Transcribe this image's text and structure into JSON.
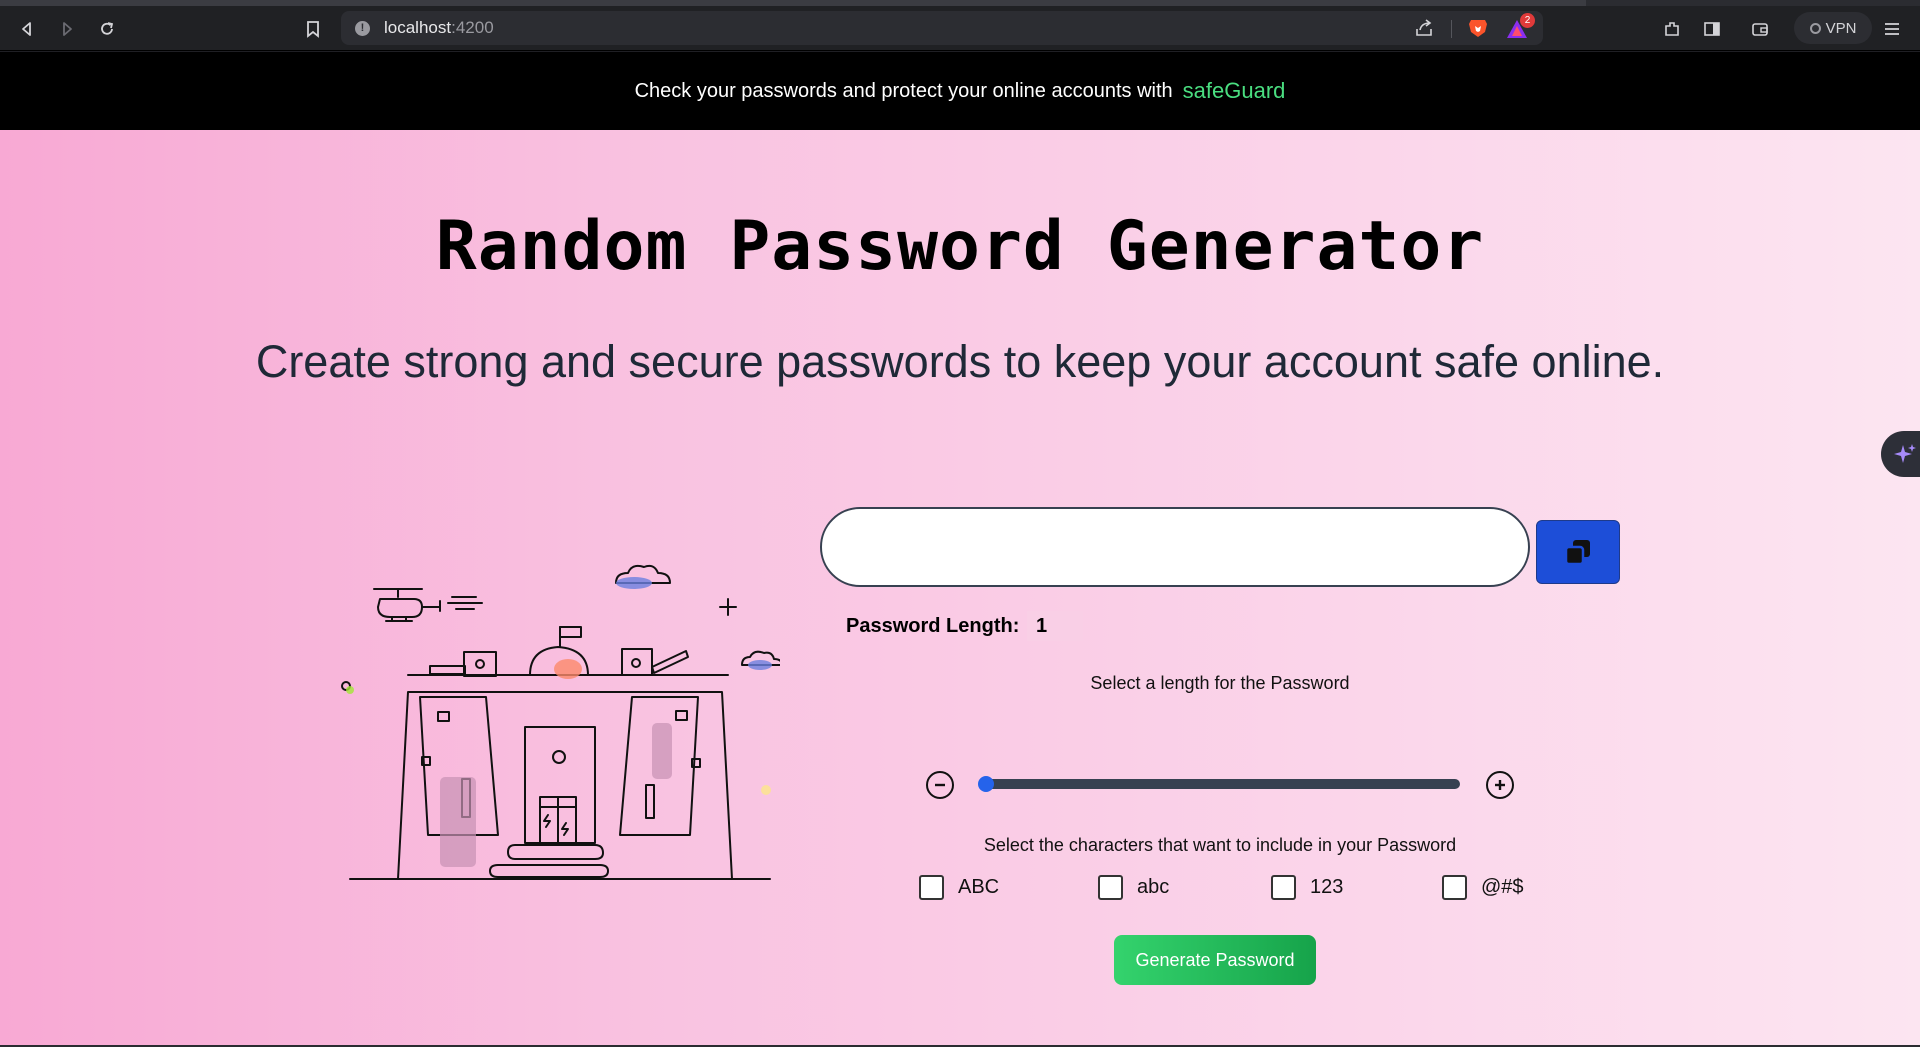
{
  "browser": {
    "url_host": "localhost",
    "url_port": ":4200",
    "vpn_label": "VPN",
    "notification_count": "2",
    "icons": [
      "back-icon",
      "forward-icon",
      "reload-icon",
      "bookmark-icon",
      "site-info-icon",
      "share-icon",
      "brave-shields-icon",
      "brave-rewards-icon",
      "extensions-icon",
      "sidebar-icon",
      "wallet-icon",
      "vpn-icon",
      "menu-icon"
    ]
  },
  "banner": {
    "text": "Check your passwords and protect your online accounts with",
    "brand": "safeGuard",
    "brand_color": "#4ade80"
  },
  "hero": {
    "title": "Random Password Generator",
    "subtitle": "Create strong and secure passwords to keep your account safe online."
  },
  "generator": {
    "password_value": "",
    "copy_icon": "copy-icon",
    "length_label": "Password Length:",
    "length_value": "1",
    "length_fraction": 0.0,
    "select_length_text": "Select a length for the Password",
    "decrease_icon": "minus-circle-icon",
    "increase_icon": "plus-circle-icon",
    "select_chars_text": "Select the characters that want to include in your Password",
    "options": [
      {
        "label": "ABC",
        "checked": false
      },
      {
        "label": "abc",
        "checked": false
      },
      {
        "label": "123",
        "checked": false
      },
      {
        "label": "@#$",
        "checked": false
      }
    ],
    "generate_label": "Generate Password",
    "accent_color": "#1d4ed8",
    "generate_color": "#22c55e"
  }
}
